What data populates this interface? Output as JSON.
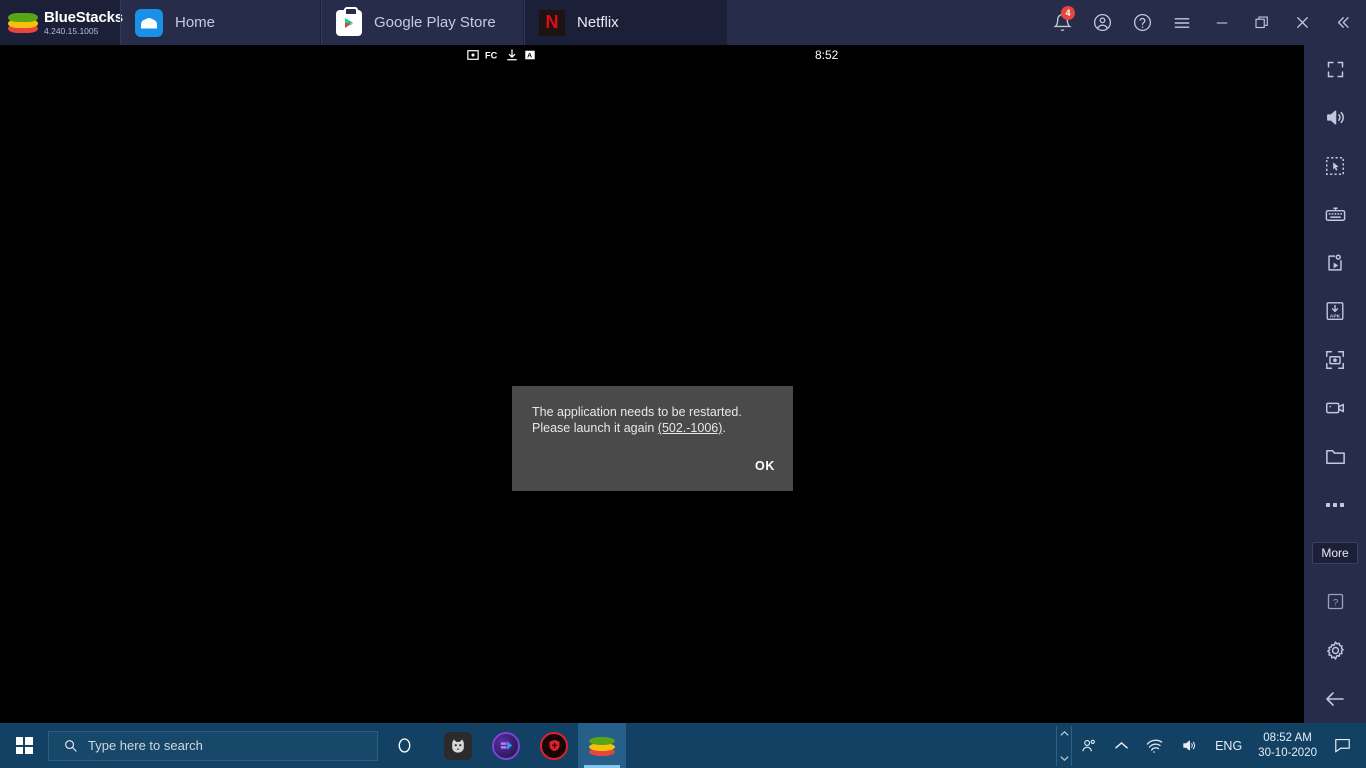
{
  "window": {
    "brand": {
      "name": "BlueStacks",
      "version": "4.240.15.1005",
      "icon": "bluestacks-logo"
    },
    "tabs": [
      {
        "label": "Home",
        "icon": "home-icon",
        "active": false
      },
      {
        "label": "Google Play Store",
        "icon": "google-play-icon",
        "active": false
      },
      {
        "label": "Netflix",
        "icon": "netflix-icon",
        "active": true
      }
    ],
    "actions": [
      {
        "name": "notifications",
        "icon": "bell-icon",
        "badge": "4"
      },
      {
        "name": "account",
        "icon": "user-circle-icon"
      },
      {
        "name": "help",
        "icon": "question-circle-icon"
      },
      {
        "name": "menu",
        "icon": "hamburger-icon"
      },
      {
        "name": "minimize",
        "icon": "minimize-icon"
      },
      {
        "name": "maximize",
        "icon": "restore-icon"
      },
      {
        "name": "close",
        "icon": "close-icon"
      },
      {
        "name": "collapse",
        "icon": "chevron-double-left-icon"
      }
    ]
  },
  "android": {
    "status_bar": {
      "icons": [
        "screenshot-icon",
        "fc-icon",
        "download-icon",
        "a-badge-icon"
      ],
      "clock": "8:52"
    },
    "dialog": {
      "message_line1": "The application needs to be restarted.",
      "message_line2_prefix": "Please launch it again ",
      "error_code": "(502.-1006)",
      "message_line2_suffix": ".",
      "ok_label": "OK"
    }
  },
  "sidebar": {
    "items": [
      {
        "name": "fullscreen",
        "icon": "fullscreen-icon"
      },
      {
        "name": "volume",
        "icon": "speaker-icon"
      },
      {
        "name": "multi-select",
        "icon": "marquee-select-icon"
      },
      {
        "name": "game-controls",
        "icon": "keyboard-icon"
      },
      {
        "name": "macro-recorder",
        "icon": "macro-play-icon"
      },
      {
        "name": "install-apk",
        "icon": "apk-install-icon"
      },
      {
        "name": "screenshot",
        "icon": "camera-icon"
      },
      {
        "name": "record-screen",
        "icon": "video-camera-icon"
      },
      {
        "name": "media-manager",
        "icon": "folder-icon"
      },
      {
        "name": "more",
        "icon": "ellipsis-icon"
      }
    ],
    "more_label": "More",
    "bottom_items": [
      {
        "name": "help",
        "icon": "question-box-icon"
      },
      {
        "name": "settings",
        "icon": "gear-icon"
      },
      {
        "name": "back",
        "icon": "arrow-left-icon"
      }
    ]
  },
  "taskbar": {
    "start": {
      "icon": "windows-logo-icon"
    },
    "search": {
      "placeholder": "Type here to search",
      "icon": "search-icon"
    },
    "cortana": {
      "icon": "cortana-circle-icon"
    },
    "apps": [
      {
        "name": "taskbar-app-1",
        "icon": "wolf-app-icon",
        "active": false
      },
      {
        "name": "taskbar-app-2",
        "icon": "purple-app-icon",
        "active": false
      },
      {
        "name": "taskbar-app-3",
        "icon": "red-shield-app-icon",
        "active": false
      },
      {
        "name": "taskbar-app-bluestacks",
        "icon": "bluestacks-logo",
        "active": true
      }
    ],
    "tray": {
      "people_icon": "people-icon",
      "show_hidden_icon": "chevron-up-icon",
      "network_icon": "wifi-icon",
      "volume_icon": "speaker-icon",
      "language": "ENG",
      "time": "08:52 AM",
      "date": "30-10-2020",
      "action_center_icon": "action-center-icon"
    }
  },
  "colors": {
    "titlebar_bg": "#272c4a",
    "active_tab_bg": "#1b1f38",
    "android_bg": "#000000",
    "dialog_bg": "#4a4a4a",
    "taskbar_bg": "#124163",
    "badge_red": "#e8453c",
    "netflix_red": "#e50914"
  }
}
